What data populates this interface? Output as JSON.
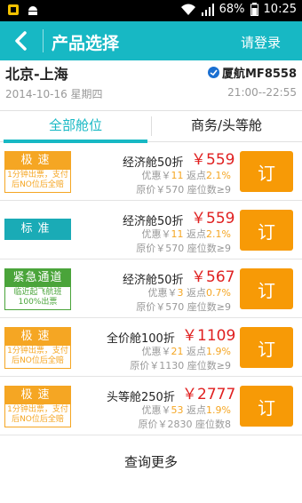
{
  "status_bar": {
    "battery": "68%",
    "time": "10:25"
  },
  "header": {
    "title": "产品选择",
    "login": "请登录"
  },
  "flight": {
    "route": "北京-上海",
    "airline": "厦航MF8558",
    "date": "2014-10-16 星期四",
    "time": "21:00--22:55"
  },
  "tabs": [
    {
      "label": "全部舱位",
      "active": true
    },
    {
      "label": "商务/头等舱",
      "active": false
    }
  ],
  "rows": [
    {
      "badge_title": "极速",
      "badge_sub1": "1分钟出票，支付",
      "badge_sub2": "后NO位后全赔",
      "badge_color": "#f5a623",
      "cabin": "经济舱50折",
      "price": "￥559",
      "disc_prefix": "优惠￥",
      "discount": "11",
      "rebate_prefix": "返点",
      "rebate": "2.1%",
      "original": "原价￥570 座位数≥9",
      "book_label": "订"
    },
    {
      "badge_title": "标准",
      "badge_sub1": "",
      "badge_sub2": "",
      "badge_color": "#1aabb6",
      "cabin": "经济舱50折",
      "price": "￥559",
      "disc_prefix": "优惠￥",
      "discount": "11",
      "rebate_prefix": "返点",
      "rebate": "2.1%",
      "original": "原价￥570 座位数≥9",
      "book_label": "订"
    },
    {
      "badge_title": "紧急通道",
      "badge_sub1": "临近起飞航班",
      "badge_sub2": "100%出票",
      "badge_color": "#4aa43a",
      "cabin": "经济舱50折",
      "price": "￥567",
      "disc_prefix": "优惠￥",
      "discount": "3",
      "rebate_prefix": "返点",
      "rebate": "0.7%",
      "original": "原价￥570 座位数≥9",
      "book_label": "订"
    },
    {
      "badge_title": "极速",
      "badge_sub1": "1分钟出票，支付",
      "badge_sub2": "后NO位后全赔",
      "badge_color": "#f5a623",
      "cabin": "全价舱100折",
      "price": "￥1109",
      "disc_prefix": "优惠￥",
      "discount": "21",
      "rebate_prefix": "返点",
      "rebate": "1.9%",
      "original": "原价￥1130 座位数≥9",
      "book_label": "订"
    },
    {
      "badge_title": "极速",
      "badge_sub1": "1分钟出票，支付",
      "badge_sub2": "后NO位后全赔",
      "badge_color": "#f5a623",
      "cabin": "头等舱250折",
      "price": "￥2777",
      "disc_prefix": "优惠￥",
      "discount": "53",
      "rebate_prefix": "返点",
      "rebate": "1.9%",
      "original": "原价￥2830 座位数8",
      "book_label": "订"
    }
  ],
  "more_label": "查询更多",
  "colors": {
    "accent": "#17b8c4",
    "price": "#e02020",
    "book": "#f79a06"
  }
}
